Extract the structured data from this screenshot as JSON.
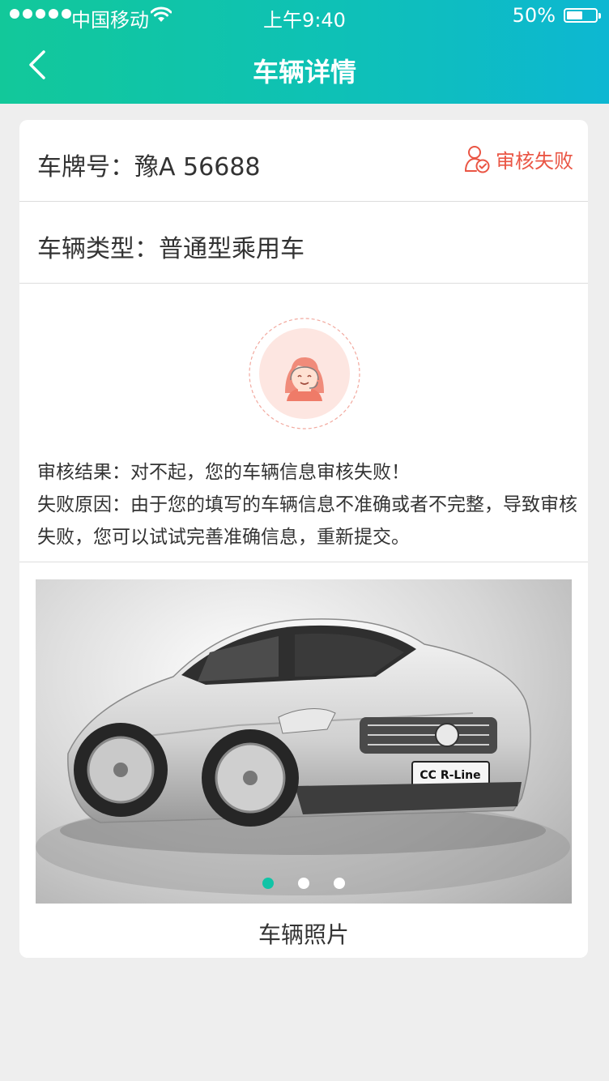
{
  "status_bar": {
    "carrier": "中国移动",
    "time": "上午9:40",
    "battery": "50%"
  },
  "nav": {
    "title": "车辆详情",
    "back_icon": "chevron-left-icon"
  },
  "vehicle": {
    "plate_label": "车牌号：",
    "plate_number": "豫A 56688",
    "review_status": "审核失败",
    "review_status_color": "#ea5544",
    "type_label": "车辆类型：",
    "type_value": "普通型乘用车"
  },
  "review": {
    "result_label": "审核结果：",
    "result_text": "对不起，您的车辆信息审核失败！",
    "reason_label": "失败原因：",
    "reason_text": "由于您的填写的车辆信息不准确或者不完整，导致审核失败，您可以试试完善准确信息，重新提交。"
  },
  "photo": {
    "caption": "车辆照片",
    "plate_text": "CC R-Line",
    "slide_count": 3,
    "active_slide": 1
  },
  "colors": {
    "accent": "#10c4a6",
    "error": "#ea5544",
    "text": "#333333",
    "background": "#eeeeee"
  }
}
